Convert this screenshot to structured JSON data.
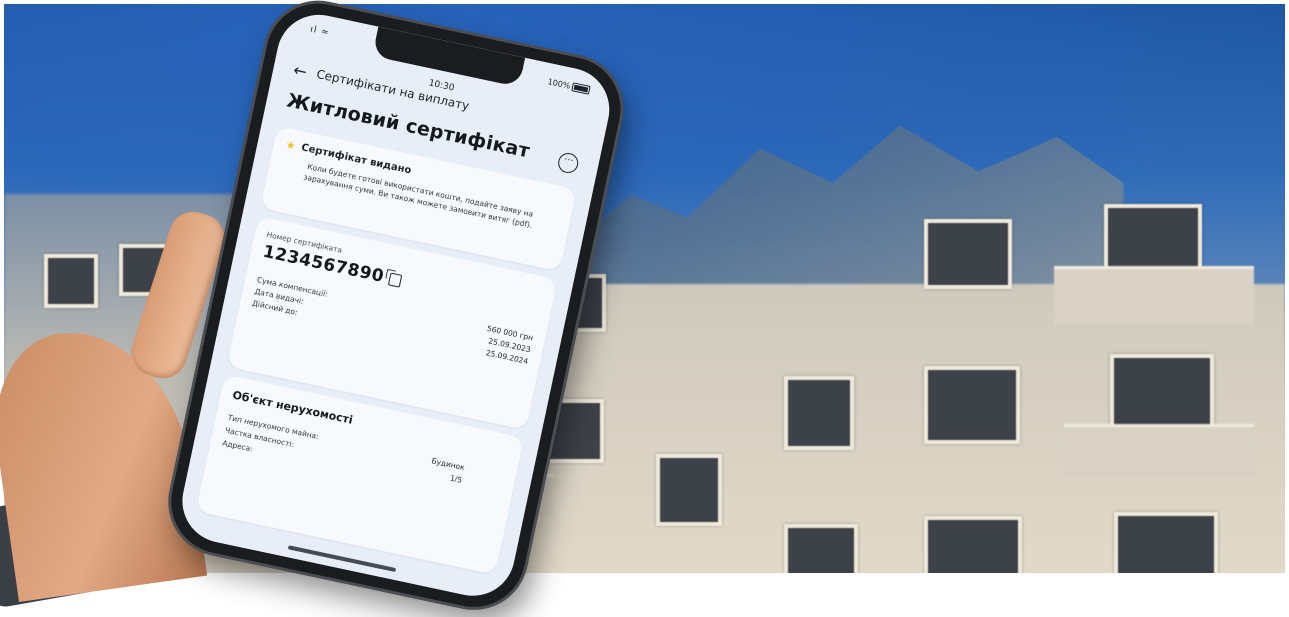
{
  "phone": {
    "status": {
      "signal": "ıl ≈",
      "time": "10:30",
      "battery": "100%"
    },
    "nav": {
      "back": "←",
      "title": "Сертифікати на виплату"
    },
    "page_title": "Житловий сертифікат",
    "more": "···",
    "status_card": {
      "icon": "★",
      "title": "Сертифікат видано",
      "description": "Коли будете готові використати кошти, подайте заяву на зарахування суми. Ви також можете замовити витяг (pdf)."
    },
    "cert_card": {
      "number_label": "Номер сертифіката",
      "number": "1234567890",
      "rows": [
        {
          "label": "Сума компенсації:",
          "value": "560 000 грн"
        },
        {
          "label": "Дата видачі:",
          "value": "25.09.2023"
        },
        {
          "label": "Дійсний до:",
          "value": "25.09.2024"
        }
      ]
    },
    "property_card": {
      "title": "Об'єкт нерухомості",
      "rows": [
        {
          "label": "Тип нерухомого майна:",
          "value": "Будинок"
        },
        {
          "label": "Частка власності:",
          "value": "1/5"
        },
        {
          "label": "Адреса:",
          "value": ""
        }
      ]
    }
  },
  "colors": {
    "sky": "#2f6cb8",
    "screen_bg": "#e7eef8",
    "card_bg": "#f7f9fc",
    "star": "#f3c21a",
    "phone_frame": "#1b1c1f"
  }
}
